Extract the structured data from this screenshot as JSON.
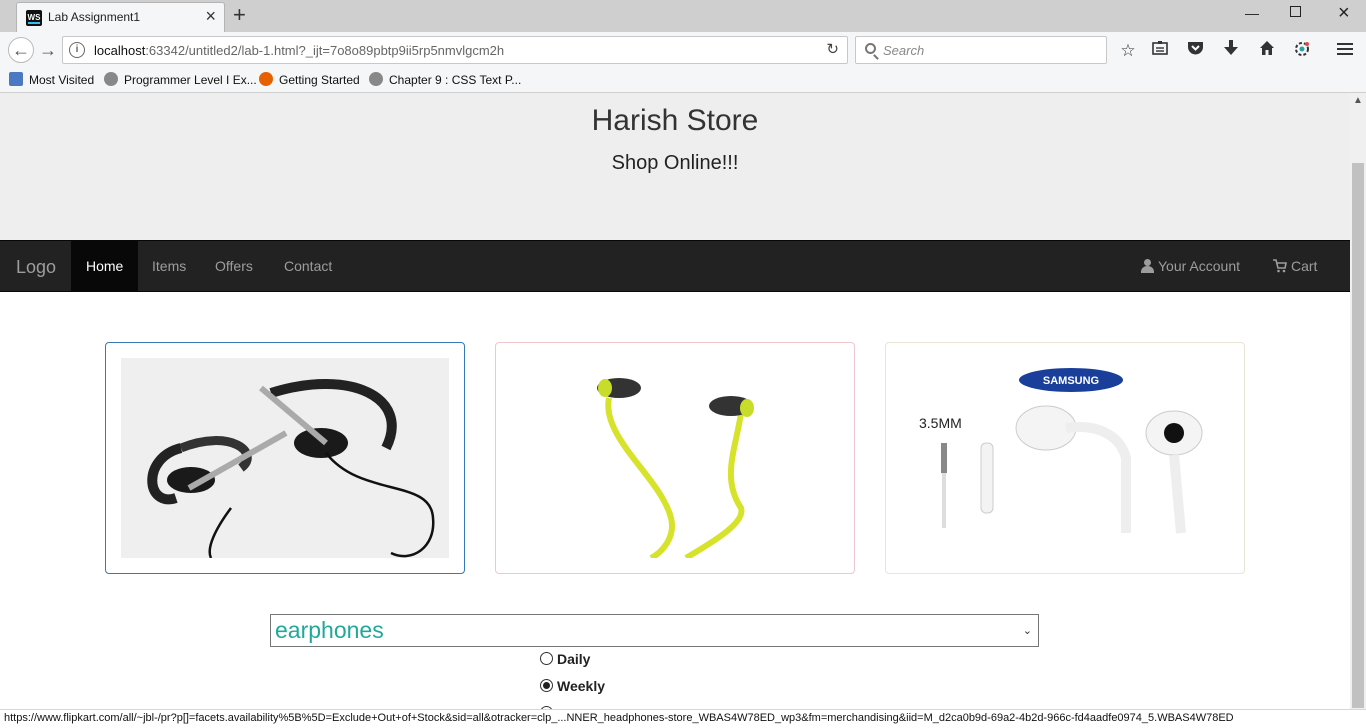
{
  "browser": {
    "tab_title": "Lab Assignment1",
    "tab_favicon": "WS",
    "url_host": "localhost",
    "url_rest": ":63342/untitled2/lab-1.html?_ijt=7o8o89pbtp9ii5rp5nmvlgcm2h",
    "search_placeholder": "Search",
    "bookmarks": [
      "Most Visited",
      "Programmer Level I Ex...",
      "Getting Started",
      "Chapter 9 : CSS Text P..."
    ],
    "status_url": "https://www.flipkart.com/all/~jbl-/pr?p[]=facets.availability%5B%5D=Exclude+Out+of+Stock&sid=all&otracker=clp_...NNER_headphones-store_WBAS4W78ED_wp3&fm=merchandising&iid=M_d2ca0b9d-69a2-4b2d-966c-fd4aadfe0974_5.WBAS4W78ED"
  },
  "page": {
    "title": "Harish Store",
    "subtitle": "Shop Online!!!",
    "nav": {
      "brand": "Logo",
      "links": [
        "Home",
        "Items",
        "Offers",
        "Contact"
      ],
      "active": "Home",
      "account": "Your Account",
      "cart": "Cart"
    },
    "products": [
      {
        "name": "wraparound-earphones",
        "icon": "earphones-image"
      },
      {
        "name": "yellow-earphones",
        "icon": "earphones-image"
      },
      {
        "name": "samsung-earphones",
        "icon": "earphones-image",
        "brand_logo": "SAMSUNG",
        "caption": "3.5MM"
      }
    ],
    "select": {
      "value": "earphones"
    },
    "radios": [
      {
        "label": "Daily",
        "checked": false
      },
      {
        "label": "Weekly",
        "checked": true
      }
    ]
  },
  "colors": {
    "jumbotron": "#eeeeee",
    "navbar": "#222222",
    "select_text": "#20a99a",
    "active_thumb_border": "#337ab7"
  }
}
